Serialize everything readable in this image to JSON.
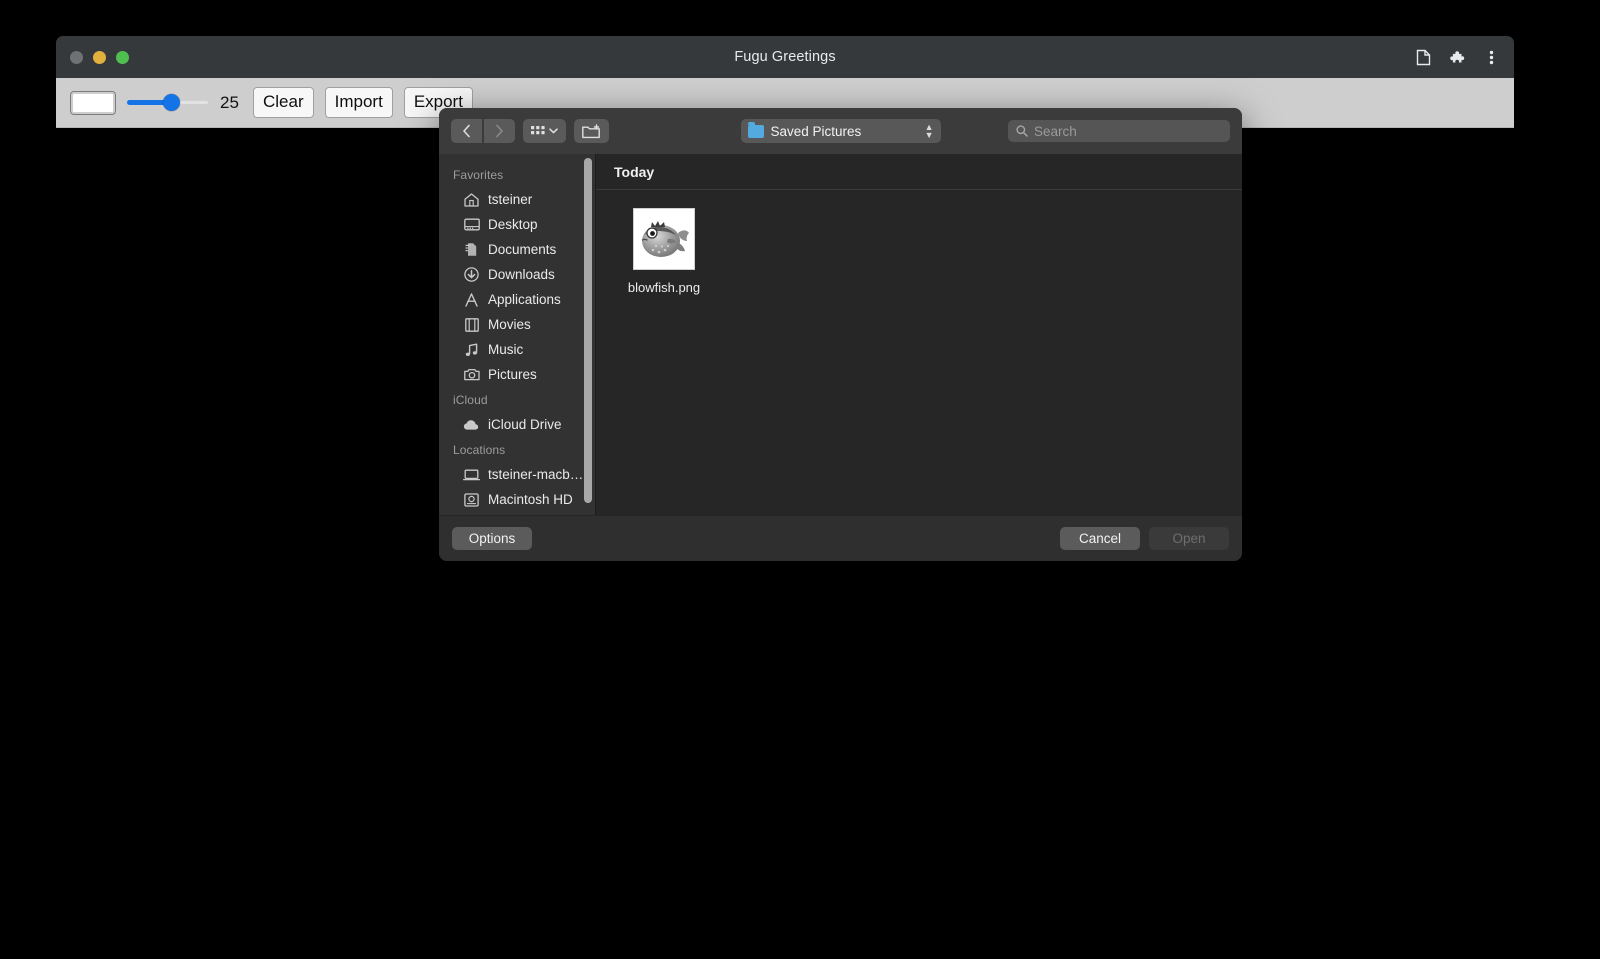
{
  "window": {
    "title": "Fugu Greetings",
    "traffic_lights": [
      "close",
      "minimize",
      "maximize"
    ],
    "title_actions": [
      {
        "name": "page-icon",
        "label": "Page"
      },
      {
        "name": "extensions-icon",
        "label": "Extensions"
      },
      {
        "name": "more-menu-icon",
        "label": "Customize and control"
      }
    ]
  },
  "app_toolbar": {
    "color_swatch_value": "#ffffff",
    "slider_value": "25",
    "buttons": [
      {
        "label": "Clear",
        "name": "clear-button"
      },
      {
        "label": "Import",
        "name": "import-button"
      },
      {
        "label": "Export",
        "name": "export-button"
      }
    ]
  },
  "dialog": {
    "nav": {
      "back": "‹",
      "forward": "›"
    },
    "view_mode": "icon-view",
    "new_folder": "new-folder",
    "path": {
      "label": "Saved Pictures",
      "icon": "folder-icon"
    },
    "search": {
      "placeholder": "Search",
      "value": ""
    },
    "sidebar": {
      "groups": [
        {
          "title": "Favorites",
          "items": [
            {
              "label": "tsteiner",
              "icon": "home-icon"
            },
            {
              "label": "Desktop",
              "icon": "desktop-icon"
            },
            {
              "label": "Documents",
              "icon": "documents-icon"
            },
            {
              "label": "Downloads",
              "icon": "downloads-icon"
            },
            {
              "label": "Applications",
              "icon": "applications-icon"
            },
            {
              "label": "Movies",
              "icon": "movies-icon"
            },
            {
              "label": "Music",
              "icon": "music-icon"
            },
            {
              "label": "Pictures",
              "icon": "pictures-icon"
            }
          ]
        },
        {
          "title": "iCloud",
          "items": [
            {
              "label": "iCloud Drive",
              "icon": "cloud-icon"
            }
          ]
        },
        {
          "title": "Locations",
          "items": [
            {
              "label": "tsteiner-macb…",
              "icon": "laptop-icon"
            },
            {
              "label": "Macintosh HD",
              "icon": "harddisk-icon"
            }
          ]
        }
      ]
    },
    "content": {
      "section_header": "Today",
      "files": [
        {
          "name": "blowfish.png",
          "thumbnail": "blowfish-thumbnail"
        }
      ]
    },
    "footer": {
      "options_label": "Options",
      "cancel_label": "Cancel",
      "open_label": "Open",
      "open_disabled": true
    }
  },
  "colors": {
    "accent_blue": "#1473e6",
    "folder_blue": "#53aae0",
    "dialog_bg": "#2b2b2b",
    "toolbar_bg": "#cecece"
  }
}
